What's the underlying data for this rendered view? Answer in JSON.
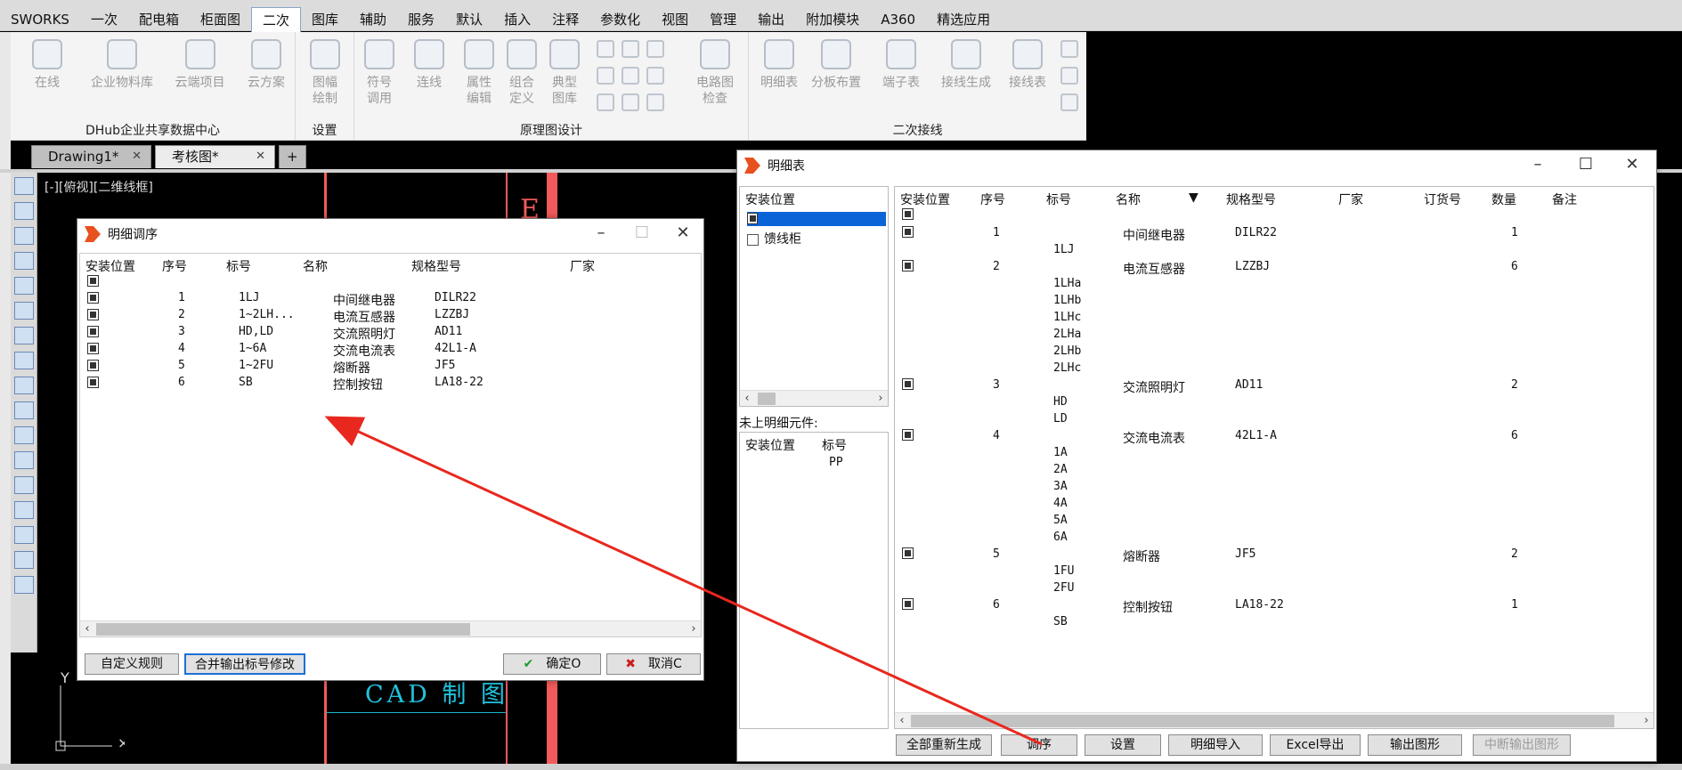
{
  "menubar": {
    "items": [
      "SWORKS",
      "一次",
      "配电箱",
      "柜面图",
      "二次",
      "图库",
      "辅助",
      "服务",
      "默认",
      "插入",
      "注释",
      "参数化",
      "视图",
      "管理",
      "输出",
      "附加模块",
      "A360",
      "精选应用"
    ],
    "active_index": 4
  },
  "ribbon": {
    "groups": [
      {
        "title": "DHub企业共享数据中心",
        "buttons": [
          "在线",
          "企业物料库",
          "云端项目",
          "云方案"
        ]
      },
      {
        "title": "设置",
        "buttons": [
          "图幅\n绘制"
        ]
      },
      {
        "title": "原理图设计",
        "buttons": [
          "符号\n调用",
          "连线",
          "属性\n编辑",
          "组合\n定义",
          "典型\n图库",
          "电路图\n检查"
        ]
      },
      {
        "title": "二次接线",
        "buttons": [
          "明细表",
          "分板布置",
          "端子表",
          "接线生成",
          "接线表"
        ]
      }
    ]
  },
  "doc_tabs": [
    {
      "label": "Drawing1*",
      "active": false
    },
    {
      "label": "考核图*",
      "active": true
    }
  ],
  "view_label": "[-][俯视][二维线框]",
  "cad_text": "CAD 制 图",
  "cad_letter": "E",
  "axis_label": "Y",
  "dialog_order": {
    "title": "明细调序",
    "columns": [
      "安装位置",
      "序号",
      "标号",
      "名称",
      "规格型号",
      "厂家"
    ],
    "rows": [
      {
        "seq": "1",
        "tag": "1LJ",
        "name": "中间继电器",
        "model": "DILR22",
        "vendor": ""
      },
      {
        "seq": "2",
        "tag": "1~2LH...",
        "name": "电流互感器",
        "model": "LZZBJ",
        "vendor": ""
      },
      {
        "seq": "3",
        "tag": "HD,LD",
        "name": "交流照明灯",
        "model": "AD11",
        "vendor": ""
      },
      {
        "seq": "4",
        "tag": "1~6A",
        "name": "交流电流表",
        "model": "42L1-A",
        "vendor": ""
      },
      {
        "seq": "5",
        "tag": "1~2FU",
        "name": "熔断器",
        "model": "JF5",
        "vendor": ""
      },
      {
        "seq": "6",
        "tag": "SB",
        "name": "控制按钮",
        "model": "LA18-22",
        "vendor": ""
      }
    ],
    "buttons": {
      "custom_rule": "自定义规则",
      "merge_output": "合并输出标号修改",
      "ok": "确定O",
      "cancel": "取消C"
    }
  },
  "dialog_detail": {
    "title": "明细表",
    "tree_header": "安装位置",
    "tree_items": [
      "",
      "馈线柜"
    ],
    "unlisted_label": "未上明细元件:",
    "unlisted_columns": [
      "安装位置",
      "标号"
    ],
    "unlisted_rows": [
      {
        "loc": "",
        "tag": "PP"
      }
    ],
    "columns": [
      "安装位置",
      "序号",
      "标号",
      "名称",
      "规格型号",
      "厂家",
      "订货号",
      "数量",
      "备注"
    ],
    "rows": [
      {
        "seq": "1",
        "tags": [
          "1LJ"
        ],
        "name": "中间继电器",
        "model": "DILR22",
        "qty": "1"
      },
      {
        "seq": "2",
        "tags": [
          "1LHa",
          "1LHb",
          "1LHc",
          "2LHa",
          "2LHb",
          "2LHc"
        ],
        "name": "电流互感器",
        "model": "LZZBJ",
        "qty": "6"
      },
      {
        "seq": "3",
        "tags": [
          "HD",
          "LD"
        ],
        "name": "交流照明灯",
        "model": "AD11",
        "qty": "2"
      },
      {
        "seq": "4",
        "tags": [
          "1A",
          "2A",
          "3A",
          "4A",
          "5A",
          "6A"
        ],
        "name": "交流电流表",
        "model": "42L1-A",
        "qty": "6"
      },
      {
        "seq": "5",
        "tags": [
          "1FU",
          "2FU"
        ],
        "name": "熔断器",
        "model": "JF5",
        "qty": "2"
      },
      {
        "seq": "6",
        "tags": [
          "SB"
        ],
        "name": "控制按钮",
        "model": "LA18-22",
        "qty": "1"
      }
    ],
    "buttons": [
      "全部重新生成",
      "调序",
      "设置",
      "明细导入",
      "Excel导出",
      "输出图形",
      "中断输出图形"
    ]
  },
  "colors": {
    "accent_red": "#e8281e",
    "cad_red": "#f25a5a",
    "cad_cyan": "#20c4df",
    "selection_blue": "#0a64d8"
  }
}
